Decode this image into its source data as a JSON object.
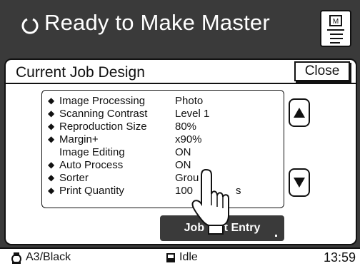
{
  "header": {
    "title": "Ready to Make Master",
    "status_icon": "ready-ring-icon",
    "master_button_icon": "master-document-icon"
  },
  "dialog": {
    "title": "Current Job Design",
    "close_label": "Close",
    "settings": [
      {
        "label": "Image Processing",
        "value": "Photo",
        "marked": true
      },
      {
        "label": "Scanning Contrast",
        "value": "Level 1",
        "marked": true
      },
      {
        "label": "Reproduction Size",
        "value": "80%",
        "marked": true
      },
      {
        "label": "Margin+",
        "value": "x90%",
        "marked": true
      },
      {
        "label": "Image Editing",
        "value": "ON",
        "marked": false
      },
      {
        "label": "Auto Process",
        "value": "ON",
        "marked": true
      },
      {
        "label": "Sorter",
        "value": "Grou",
        "marked": true
      },
      {
        "label": "Print Quantity",
        "value": "100",
        "marked": true
      }
    ],
    "print_quantity_suffix": "s",
    "marker_glyph": "◆",
    "scroll_up_icon": "triangle-up-icon",
    "scroll_down_icon": "triangle-down-icon",
    "job_list_label": "Job List Entry",
    "pointer_icon": "pointing-hand-icon"
  },
  "statusbar": {
    "paper": "A3/Black",
    "paper_icon": "ink-drum-icon",
    "state": "Idle",
    "state_icon": "machine-state-icon",
    "time": "13:59"
  },
  "colors": {
    "panel_dark": "#3a3a3a",
    "text_light": "#ffffff",
    "panel_light": "#ffffff",
    "ink": "#111111"
  }
}
